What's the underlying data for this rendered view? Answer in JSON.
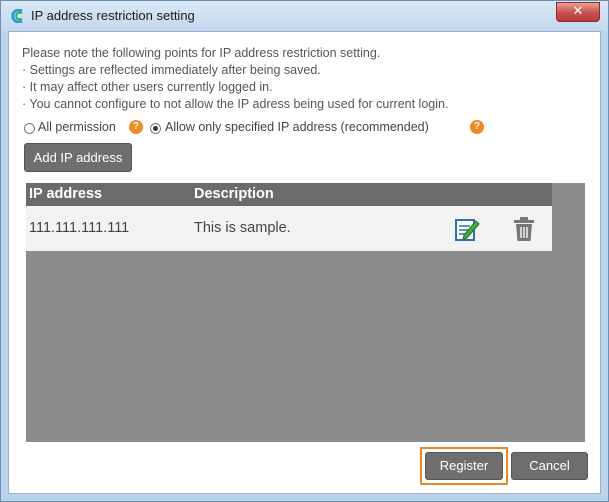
{
  "window": {
    "title": "IP address restriction setting",
    "close_label": "✕"
  },
  "notes": [
    "Please note the following points for IP address restriction setting.",
    "· Settings are reflected immediately after being saved.",
    "· It may affect other users currently logged in.",
    "· You cannot configure to not allow the IP adress being used for current login."
  ],
  "permission": {
    "all_label": "All permission",
    "specified_label": "Allow only specified IP address (recommended)",
    "selected": "specified",
    "help_glyph": "?"
  },
  "add_button_label": "Add IP address",
  "table": {
    "columns": [
      "IP address",
      "Description"
    ],
    "rows": [
      {
        "ip": "111.111.111.111",
        "description": "This is sample."
      }
    ]
  },
  "footer": {
    "register_label": "Register",
    "cancel_label": "Cancel"
  },
  "colors": {
    "accent_outline": "#f0841e",
    "button_gray": "#6e6e6e",
    "table_bg": "#8c8c8c",
    "help_orange": "#f08c1e"
  },
  "icons": {
    "app": "app-logo-icon",
    "help": "question-icon",
    "edit": "edit-icon",
    "delete": "trash-icon",
    "close": "close-icon"
  }
}
